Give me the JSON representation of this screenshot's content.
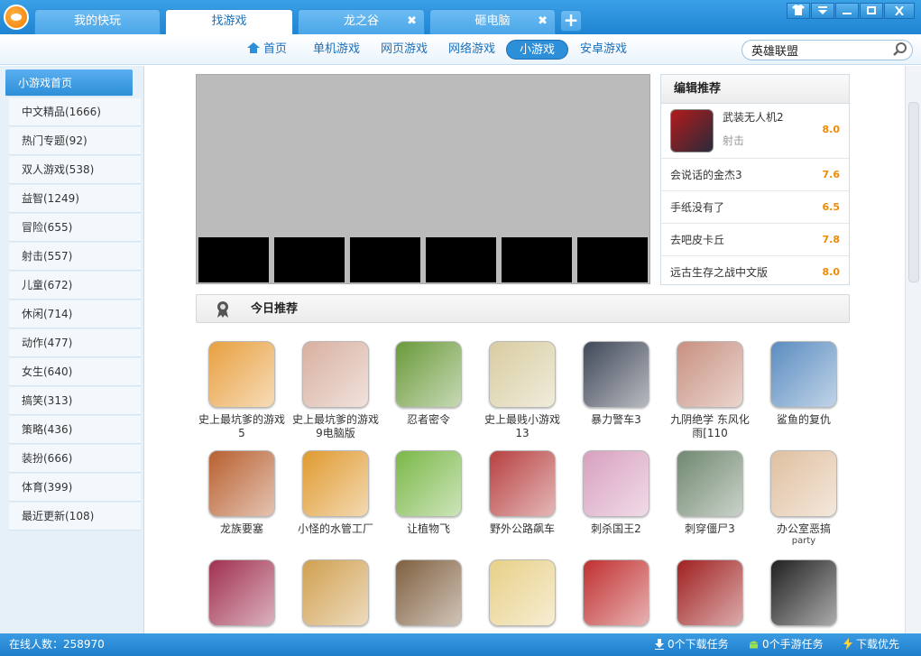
{
  "tabs": [
    {
      "label": "我的快玩",
      "closable": false,
      "active": false
    },
    {
      "label": "找游戏",
      "closable": false,
      "active": true
    },
    {
      "label": "龙之谷",
      "closable": true,
      "active": false
    },
    {
      "label": "砸电脑",
      "closable": true,
      "active": false
    }
  ],
  "window_controls": [
    "shirt-icon",
    "dropdown-icon",
    "minimize-icon",
    "maximize-icon",
    "close-icon"
  ],
  "nav": {
    "home": "首页",
    "items": [
      "单机游戏",
      "网页游戏",
      "网络游戏",
      "小游戏",
      "安卓游戏"
    ],
    "active": "小游戏"
  },
  "search": {
    "value": "英雄联盟"
  },
  "sidebar": {
    "items": [
      "小游戏首页",
      "中文精品(1666)",
      "热门专题(92)",
      "双人游戏(538)",
      "益智(1249)",
      "冒险(655)",
      "射击(557)",
      "儿童(672)",
      "休闲(714)",
      "动作(477)",
      "女生(640)",
      "搞笑(313)",
      "策略(436)",
      "装扮(666)",
      "体育(399)",
      "最近更新(108)"
    ]
  },
  "editor_pick": {
    "title": "编辑推荐",
    "featured": {
      "name": "武装无人机2",
      "category": "射击",
      "score": "8.0"
    },
    "items": [
      {
        "name": "会说话的金杰3",
        "score": "7.6"
      },
      {
        "name": "手纸没有了",
        "score": "6.5"
      },
      {
        "name": "去吧皮卡丘",
        "score": "7.8"
      },
      {
        "name": "远古生存之战中文版",
        "score": "8.0"
      }
    ]
  },
  "today": {
    "title": "今日推荐",
    "games": [
      {
        "name": "史上最坑爹的游戏5",
        "color": "#e8a040"
      },
      {
        "name": "史上最坑爹的游戏9电脑版",
        "color": "#d8b0a0"
      },
      {
        "name": "忍者密令",
        "color": "#6a9a3a"
      },
      {
        "name": "史上最贱小游戏13",
        "color": "#d8cca0"
      },
      {
        "name": "暴力警车3",
        "color": "#404858"
      },
      {
        "name": "九阴绝学 东风化雨[110",
        "color": "#c89080"
      },
      {
        "name": "鲨鱼的复仇",
        "color": "#5a8cc0"
      },
      {
        "name": "龙族要塞",
        "color": "#b86030"
      },
      {
        "name": "小怪的水管工厂",
        "color": "#e09a30"
      },
      {
        "name": "让植物飞",
        "color": "#7ab848"
      },
      {
        "name": "野外公路飙车",
        "color": "#b84040"
      },
      {
        "name": "刺杀国王2",
        "color": "#d8a0c0"
      },
      {
        "name": "刺穿僵尸3",
        "color": "#708870"
      },
      {
        "name": "办公室恶搞",
        "sub": "party",
        "color": "#e0c0a0"
      },
      {
        "name": "",
        "color": "#a03050"
      },
      {
        "name": "",
        "color": "#d0a050"
      },
      {
        "name": "",
        "color": "#806040"
      },
      {
        "name": "",
        "color": "#e8d088"
      },
      {
        "name": "",
        "color": "#c03030"
      },
      {
        "name": "",
        "color": "#a02020"
      },
      {
        "name": "",
        "color": "#202020"
      }
    ]
  },
  "status": {
    "online": "在线人数：258970",
    "downloads": "0个下载任务",
    "mobile": "0个手游任务",
    "priority": "下载优先"
  }
}
